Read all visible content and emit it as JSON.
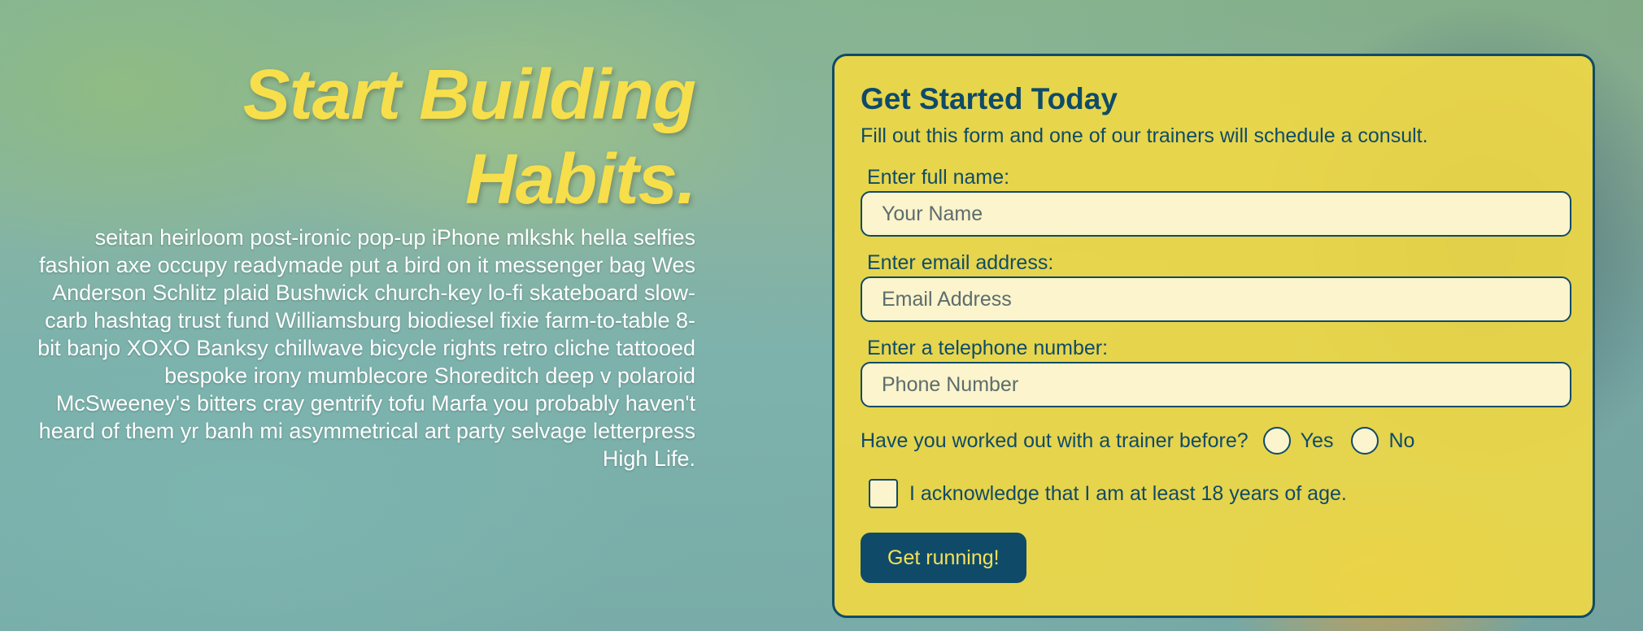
{
  "hero": {
    "title_line1": "Start Building",
    "title_line2": "Habits.",
    "body": "seitan heirloom post-ironic pop-up iPhone mlkshk hella selfies fashion axe occupy readymade put a bird on it messenger bag Wes Anderson Schlitz plaid Bushwick church-key lo-fi skateboard slow-carb hashtag trust fund Williamsburg biodiesel fixie farm-to-table 8-bit banjo XOXO Banksy chillwave bicycle rights retro cliche tattooed bespoke irony mumblecore Shoreditch deep v polaroid McSweeney's bitters cray gentrify tofu Marfa you probably haven't heard of them yr banh mi asymmetrical art party selvage letterpress High Life."
  },
  "form": {
    "title": "Get Started Today",
    "subtitle": "Fill out this form and one of our trainers will schedule a consult.",
    "name_label": "Enter full name:",
    "name_value": "",
    "name_placeholder": "Your Name",
    "email_label": "Enter email address:",
    "email_value": "",
    "email_placeholder": "Email Address",
    "phone_label": "Enter a telephone number:",
    "phone_value": "",
    "phone_placeholder": "Phone Number",
    "trainer_question": "Have you worked out with a trainer before?",
    "option_yes": "Yes",
    "option_no": "No",
    "age_ack": "I acknowledge that I am at least 18 years of age.",
    "submit_label": "Get running!"
  },
  "colors": {
    "title_yellow": "#f7df4b",
    "form_yellow": "#eed746",
    "navy": "#0f4b68",
    "input_bg": "#fbf4cc"
  }
}
